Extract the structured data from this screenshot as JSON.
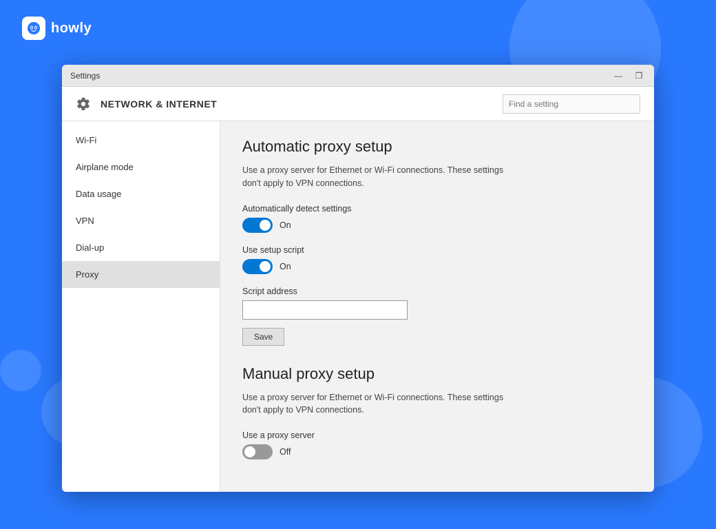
{
  "background": {
    "color": "#2979ff"
  },
  "howly": {
    "text": "howly"
  },
  "window": {
    "title": "Settings",
    "minimize": "—",
    "maximize": "❐"
  },
  "header": {
    "title": "NETWORK & INTERNET",
    "search_placeholder": "Find a setting"
  },
  "sidebar": {
    "items": [
      {
        "label": "Wi-Fi",
        "active": false
      },
      {
        "label": "Airplane mode",
        "active": false
      },
      {
        "label": "Data usage",
        "active": false
      },
      {
        "label": "VPN",
        "active": false
      },
      {
        "label": "Dial-up",
        "active": false
      },
      {
        "label": "Proxy",
        "active": true
      }
    ]
  },
  "content": {
    "auto_proxy": {
      "title": "Automatic proxy setup",
      "description": "Use a proxy server for Ethernet or Wi-Fi connections. These settings don't apply to VPN connections.",
      "auto_detect": {
        "label": "Automatically detect settings",
        "state": "on",
        "state_label": "On"
      },
      "use_script": {
        "label": "Use setup script",
        "state": "on",
        "state_label": "On"
      },
      "script_address": {
        "label": "Script address",
        "placeholder": "",
        "value": ""
      },
      "save_button": "Save"
    },
    "manual_proxy": {
      "title": "Manual proxy setup",
      "description": "Use a proxy server for Ethernet or Wi-Fi connections. These settings don't apply to VPN connections.",
      "use_proxy": {
        "label": "Use a proxy server",
        "state": "off",
        "state_label": "Off"
      }
    }
  }
}
